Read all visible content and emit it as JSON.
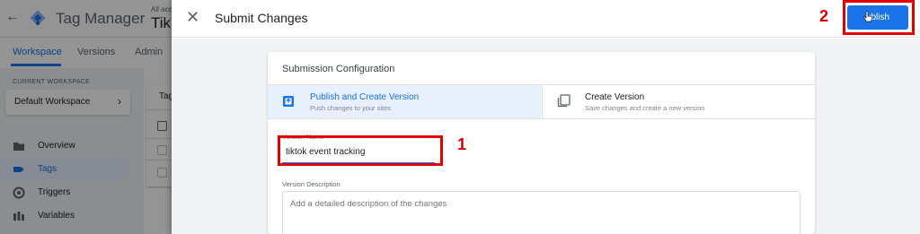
{
  "app": {
    "title": "Tag Manager",
    "account_small": "All acc",
    "container_name": "TikT"
  },
  "tabs": [
    {
      "label": "Workspace",
      "active": true
    },
    {
      "label": "Versions",
      "active": false
    },
    {
      "label": "Admin",
      "active": false
    }
  ],
  "sidebar": {
    "workspace_caption": "CURRENT WORKSPACE",
    "workspace_name": "Default Workspace",
    "items": [
      {
        "label": "Overview",
        "icon": "folder-icon",
        "active": false
      },
      {
        "label": "Tags",
        "icon": "tag-icon",
        "active": true
      },
      {
        "label": "Triggers",
        "icon": "trigger-icon",
        "active": false
      },
      {
        "label": "Variables",
        "icon": "variables-icon",
        "active": false
      }
    ]
  },
  "content": {
    "card_title": "Tag"
  },
  "panel": {
    "title": "Submit Changes",
    "publish_label": "ublish",
    "config_title": "Submission Configuration",
    "options": [
      {
        "title": "Publish and Create Version",
        "subtitle": "Push changes to your sites",
        "selected": true,
        "icon": "publish-version-icon"
      },
      {
        "title": "Create Version",
        "subtitle": "Save changes and create a new version",
        "selected": false,
        "icon": "create-version-icon"
      }
    ],
    "version_name_label": "Version Name",
    "version_name_value": "tiktok event tracking",
    "version_description_label": "Version Description",
    "version_description_placeholder": "Add a detailed description of the changes"
  },
  "annotations": {
    "step1": "1",
    "step2": "2",
    "color": "#e00000"
  },
  "colors": {
    "accent": "#1a73e8",
    "annotation": "#e00000"
  }
}
